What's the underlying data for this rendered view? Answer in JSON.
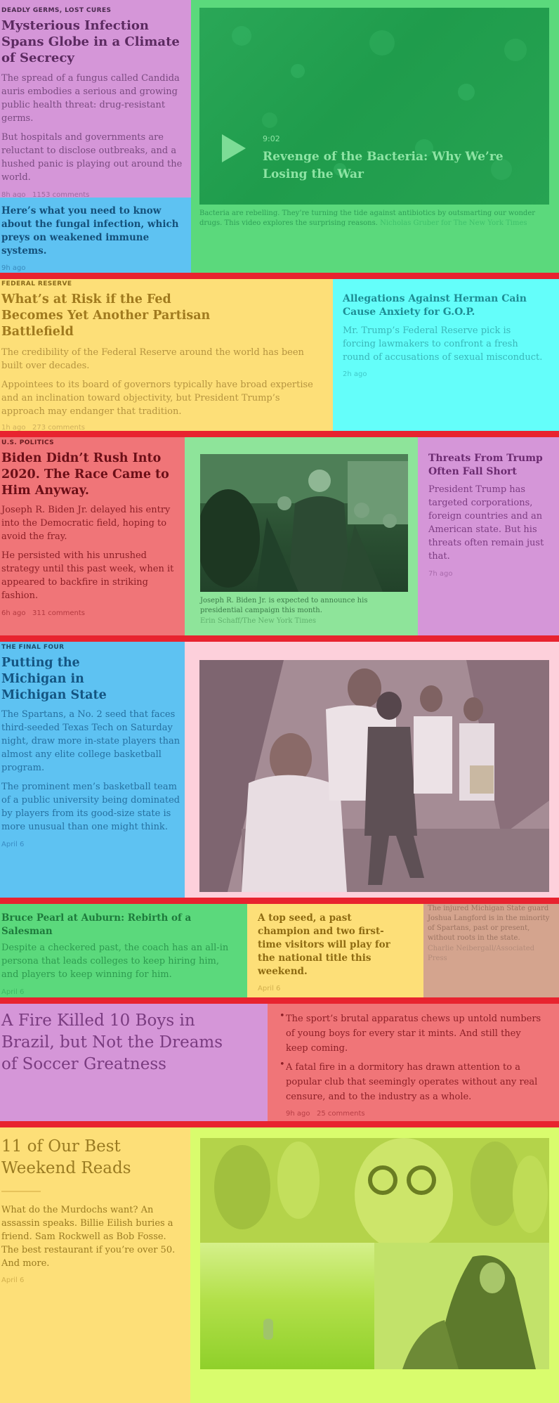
{
  "colors": {
    "separator": "#e8232f",
    "violet": "#d596d8",
    "blue": "#5ec2f2",
    "green": "#5bd97c",
    "yellow": "#fddf78",
    "cyan": "#64fefa",
    "red": "#f07578",
    "lightgreen": "#8ee49a",
    "pink": "#fdd0db",
    "tan": "#d4a48e",
    "lime": "#d9fc6d"
  },
  "s1": {
    "kicker": "Deadly Germs, Lost Cures",
    "headline": "Mysterious Infection Spans Globe in a Climate of Secrecy",
    "summary1": "The spread of a fungus called Candida auris embodies a serious and growing public health threat: drug-resistant germs.",
    "summary2": "But hospitals and governments are reluctant to disclose outbreaks, and a hushed panic is playing out around the world.",
    "meta": "8h ago   1153 comments",
    "sub_link": "Here’s what you need to know about the fungal infection, which preys on weakened immune systems.",
    "sub_meta": "9h ago",
    "video": {
      "play_icon": "play-icon",
      "duration": "9:02",
      "title": "Revenge of the Bacteria: Why We’re Losing the War",
      "caption": "Bacteria are rebelling. They’re turning the tide against antibiotics by outsmarting our wonder drugs. This video explores the surprising reasons.",
      "credit": "Nicholas Gruber for The New York Times"
    }
  },
  "s2": {
    "kicker": "Federal Reserve",
    "headline": "What’s at Risk if the Fed Becomes Yet Another Partisan Battlefield",
    "summary1": "The credibility of the Federal Reserve around the world has been built over decades.",
    "summary2": "Appointees to its board of governors typically have broad expertise and an inclination toward objectivity, but President Trump’s approach may endanger that tradition.",
    "meta": "1h ago   273 comments",
    "side_headline": "Allegations Against Herman Cain Cause Anxiety for G.O.P.",
    "side_summary": "Mr. Trump’s Federal Reserve pick is forcing lawmakers to confront a fresh round of accusations of sexual misconduct.",
    "side_meta": "2h ago"
  },
  "s3": {
    "kicker": "U.S. Politics",
    "headline": "Biden Didn’t Rush Into 2020. The Race Came to Him Anyway.",
    "summary1": "Joseph R. Biden Jr. delayed his entry into the Democratic field, hoping to avoid the fray.",
    "summary2": "He persisted with his unrushed strategy until this past week, when it appeared to backfire in striking fashion.",
    "meta": "6h ago   311 comments",
    "caption": "Joseph R. Biden Jr. is expected to announce his presidential campaign this month.",
    "credit": "Erin Schaff/The New York Times",
    "side_headline": "Threats From Trump Often Fall Short",
    "side_summary": "President Trump has targeted corporations, foreign countries and an American state. But his threats often remain just that.",
    "side_meta": "7h ago"
  },
  "s4": {
    "kicker": "The Final Four",
    "headline": "Putting the Michigan in Michigan State",
    "summary1": "The Spartans, a No. 2 seed that faces third-seeded Texas Tech on Saturday night, draw more in-state players than almost any elite college basketball program.",
    "summary2": "The prominent men’s basketball team of a public university being dominated by players from its good-size state is more unusual than one might think.",
    "meta": "April 6"
  },
  "s5": {
    "headline1": "Bruce Pearl at Auburn: Rebirth of a Salesman",
    "summary1": "Despite a checkered past, the coach has an all-in persona that leads colleges to keep hiring him, and players to keep winning for him.",
    "meta1": "April 6",
    "headline2": "A top seed, a past champion and two first-time visitors will play for the national title this weekend.",
    "meta2": "April 6",
    "caption": "The injured Michigan State guard Joshua Langford is in the minority of Spartans, past or present, without roots in the state.",
    "credit": "Charlie Neibergall/Associated Press"
  },
  "s6": {
    "headline": "A Fire Killed 10 Boys in Brazil, but Not the Dreams of Soccer Greatness",
    "bullet1": "The sport’s brutal apparatus chews up untold numbers of young boys for every star it mints. And still they keep coming.",
    "bullet2": "A fatal fire in a dormitory has drawn attention to a popular club that seemingly operates without any real censure, and to the industry as a whole.",
    "meta": "9h ago   25 comments"
  },
  "s7": {
    "headline": "11 of Our Best Weekend Reads",
    "summary": "What do the Murdochs want? An assassin speaks. Billie Eilish buries a friend. Sam Rockwell as Bob Fosse. The best restaurant if you’re over 50. And more.",
    "meta": "April 6"
  }
}
